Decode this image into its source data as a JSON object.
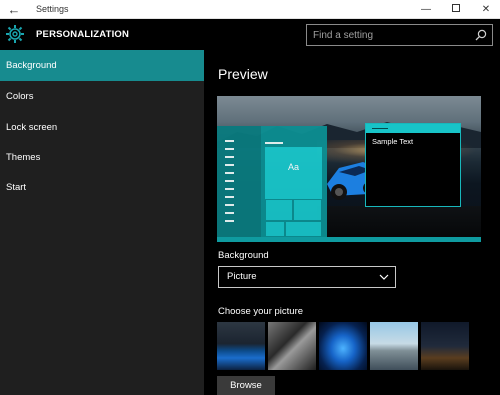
{
  "window": {
    "title": "Settings",
    "back_glyph": "←",
    "minimize_glyph": "—",
    "close_glyph": "✕"
  },
  "header": {
    "title": "PERSONALIZATION",
    "icon": "gear-icon",
    "search_placeholder": "Find a setting"
  },
  "sidebar": {
    "items": [
      {
        "label": "Background",
        "active": true
      },
      {
        "label": "Colors",
        "active": false
      },
      {
        "label": "Lock screen",
        "active": false
      },
      {
        "label": "Themes",
        "active": false
      },
      {
        "label": "Start",
        "active": false
      }
    ]
  },
  "main": {
    "preview_heading": "Preview",
    "preview_tile_label": "Aa",
    "preview_window_text": "Sample Text",
    "background_label": "Background",
    "background_value": "Picture",
    "choose_label": "Choose your picture",
    "browse_label": "Browse"
  },
  "colors": {
    "accent": "#178b8f",
    "tile": "#18c4c8",
    "sidebar_bg": "#1f1f1f"
  }
}
